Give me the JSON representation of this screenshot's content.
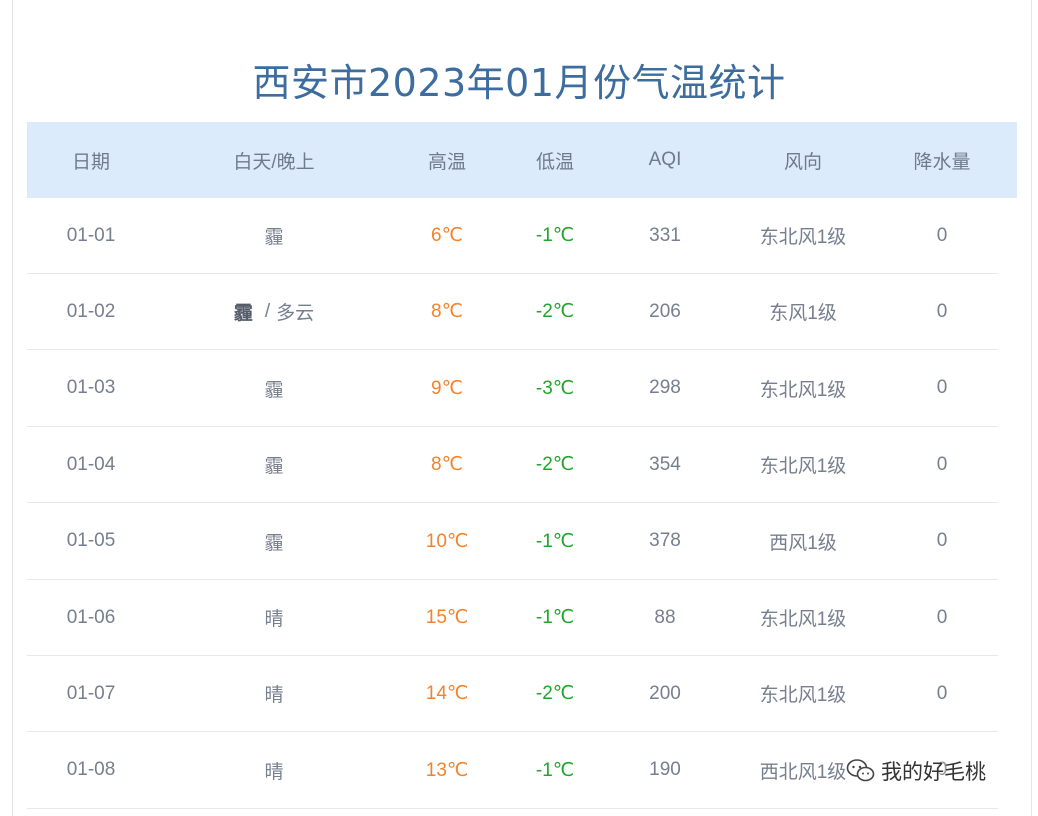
{
  "title": "西安市2023年01月份气温统计",
  "table": {
    "headers": [
      "日期",
      "白天/晚上",
      "高温",
      "低温",
      "AQI",
      "风向",
      "降水量"
    ],
    "rows": [
      {
        "date": "01-01",
        "weather_day": "霾",
        "weather_night": "",
        "high": "6℃",
        "low": "-1℃",
        "aqi": "331",
        "wind": "东北风1级",
        "precip": "0"
      },
      {
        "date": "01-02",
        "weather_day": "霾",
        "weather_night": "多云",
        "high": "8℃",
        "low": "-2℃",
        "aqi": "206",
        "wind": "东风1级",
        "precip": "0"
      },
      {
        "date": "01-03",
        "weather_day": "霾",
        "weather_night": "",
        "high": "9℃",
        "low": "-3℃",
        "aqi": "298",
        "wind": "东北风1级",
        "precip": "0"
      },
      {
        "date": "01-04",
        "weather_day": "霾",
        "weather_night": "",
        "high": "8℃",
        "low": "-2℃",
        "aqi": "354",
        "wind": "东北风1级",
        "precip": "0"
      },
      {
        "date": "01-05",
        "weather_day": "霾",
        "weather_night": "",
        "high": "10℃",
        "low": "-1℃",
        "aqi": "378",
        "wind": "西风1级",
        "precip": "0"
      },
      {
        "date": "01-06",
        "weather_day": "晴",
        "weather_night": "",
        "high": "15℃",
        "low": "-1℃",
        "aqi": "88",
        "wind": "东北风1级",
        "precip": "0"
      },
      {
        "date": "01-07",
        "weather_day": "晴",
        "weather_night": "",
        "high": "14℃",
        "low": "-2℃",
        "aqi": "200",
        "wind": "东北风1级",
        "precip": "0"
      },
      {
        "date": "01-08",
        "weather_day": "晴",
        "weather_night": "",
        "high": "13℃",
        "low": "-1℃",
        "aqi": "190",
        "wind": "西北风1级",
        "precip": "0"
      }
    ]
  },
  "watermark": {
    "text": "我的好毛桃",
    "icon": "wechat-icon"
  },
  "colors": {
    "title": "#3d6c9e",
    "header_bg": "#dcebfb",
    "high_temp": "#f5822b",
    "low_temp": "#21a42a",
    "text": "#767f8f"
  }
}
